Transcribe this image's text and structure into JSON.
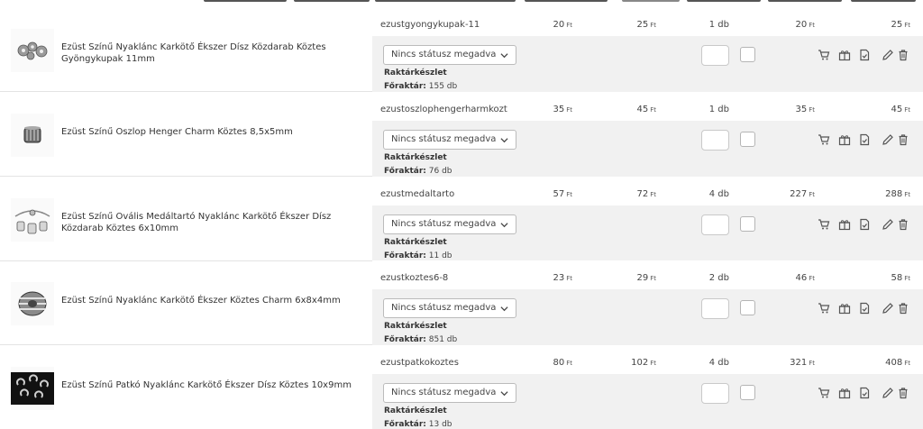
{
  "currency": "Ft",
  "status_placeholder": "Nincs státusz megadva",
  "stock_label": "Raktárkészlet",
  "warehouse_label": "Főraktár:",
  "colors": {
    "band_gray": "#f1f1f1",
    "border": "#e3e3e3",
    "text": "#444444",
    "icon": "#555555"
  },
  "rows": [
    {
      "name": "Ezüst Színű Nyaklánc Karkötő Ékszer Dísz Közdarab Köztes Gyöngykupak 11mm",
      "sku": "ezustgyongykupak-11",
      "price_net": "20",
      "price_gross": "25",
      "qty": "1 db",
      "sum_net": "20",
      "sum_gross": "25",
      "stock": "155 db",
      "thumb": "beadcap-icon"
    },
    {
      "name": "Ezüst Színű Oszlop Henger Charm Köztes 8,5x5mm",
      "sku": "ezustoszlophengerharmkozt",
      "price_net": "35",
      "price_gross": "45",
      "qty": "1 db",
      "sum_net": "35",
      "sum_gross": "45",
      "stock": "76 db",
      "thumb": "cylinder-charm-icon"
    },
    {
      "name": "Ezüst Színű Ovális Medáltartó Nyaklánc Karkötő Ékszer Dísz Közdarab Köztes 6x10mm",
      "sku": "ezustmedaltarto",
      "price_net": "57",
      "price_gross": "72",
      "qty": "4 db",
      "sum_net": "227",
      "sum_gross": "288",
      "stock": "11 db",
      "thumb": "pendant-holder-icon"
    },
    {
      "name": "Ezüst Színű Nyaklánc Karkötő Ékszer Köztes Charm 6x8x4mm",
      "sku": "ezustkoztes6-8",
      "price_net": "23",
      "price_gross": "29",
      "qty": "2 db",
      "sum_net": "46",
      "sum_gross": "58",
      "stock": "851 db",
      "thumb": "ribbed-bead-icon"
    },
    {
      "name": "Ezüst Színű Patkó Nyaklánc Karkötő Ékszer Dísz Köztes 10x9mm",
      "sku": "ezustpatkokoztes",
      "price_net": "80",
      "price_gross": "102",
      "qty": "4 db",
      "sum_net": "321",
      "sum_gross": "408",
      "stock": "13 db",
      "thumb": "horseshoe-icon"
    }
  ]
}
